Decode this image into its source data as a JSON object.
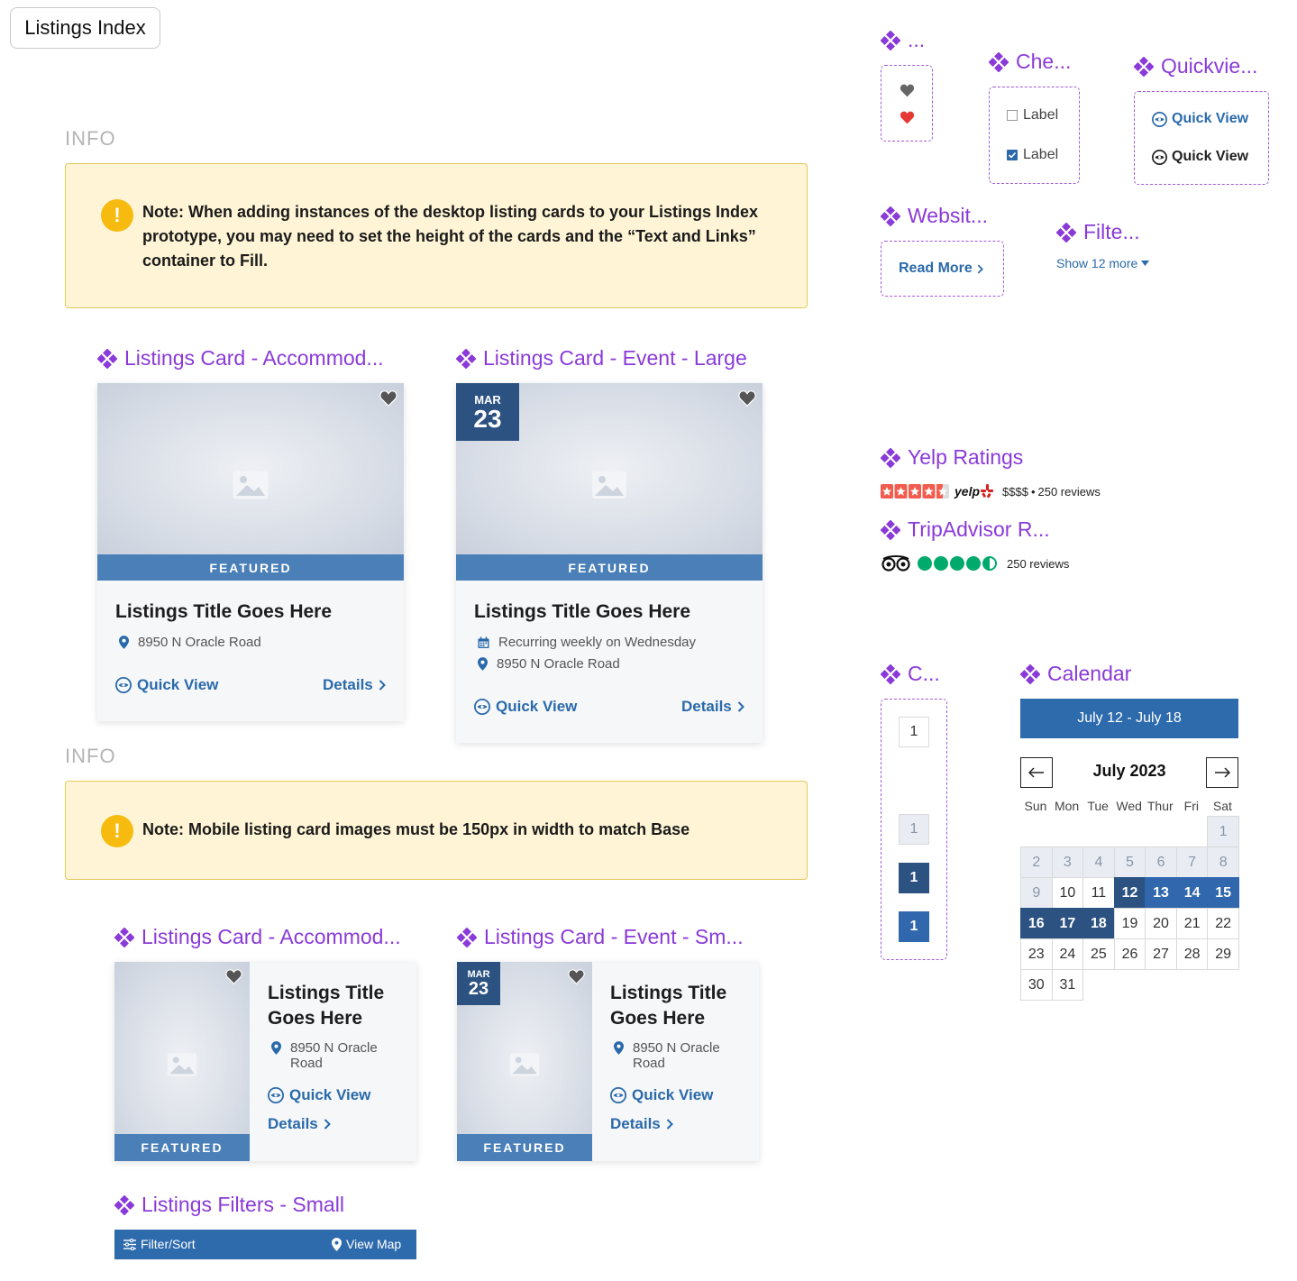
{
  "page": {
    "title": "Listings Index"
  },
  "info_sections": [
    {
      "label": "INFO",
      "note": "Note: When adding instances of the desktop listing cards to your Listings Index prototype, you may need to set the height of the cards and the “Text and Links” container to Fill."
    },
    {
      "label": "INFO",
      "note": "Note: Mobile listing card images must be 150px in width to match Base"
    }
  ],
  "components": {
    "favorite": "...",
    "checkbox": "Che...",
    "quickview": "Quickvie...",
    "website": "Websit...",
    "filter": "Filte...",
    "yelp": "Yelp Ratings",
    "tripadvisor": "TripAdvisor R...",
    "counter": "C...",
    "calendar": "Calendar",
    "card_accom_large": "Listings Card - Accommod...",
    "card_event_large": "Listings Card - Event - Large",
    "card_accom_small": "Listings Card - Accommod...",
    "card_event_small": "Listings Card - Event - Sm...",
    "filters_small": "Listings Filters - Small"
  },
  "card": {
    "featured": "FEATURED",
    "title": "Listings Title Goes Here",
    "title_line1": "Listings Title",
    "title_line2": "Goes Here",
    "address": "8950 N Oracle Road",
    "address_line1": "8950 N Oracle",
    "address_line2": "Road",
    "recurring": "Recurring weekly on Wednesday",
    "quick_view": "Quick View",
    "details": "Details",
    "month": "MAR",
    "day": "23"
  },
  "checkbox": {
    "label_unchecked": "Label",
    "label_checked": "Label",
    "checked": [
      false,
      true
    ]
  },
  "quickview_items": [
    "Quick View",
    "Quick View"
  ],
  "website": {
    "read_more": "Read More"
  },
  "filter_show": "Show 12 more",
  "yelp": {
    "stars": 4.5,
    "brand": "yelp",
    "price": "$$$$",
    "sep": "•",
    "reviews": "250 reviews"
  },
  "tripadvisor": {
    "rating": 4.5,
    "reviews": "250 reviews"
  },
  "counter": [
    "1",
    "1",
    "1",
    "1"
  ],
  "calendar": {
    "range": "July 12 - July 18",
    "month": "July 2023",
    "dow": [
      "Sun",
      "Mon",
      "Tue",
      "Wed",
      "Thur",
      "Fri",
      "Sat"
    ],
    "days": [
      "1",
      "2",
      "3",
      "4",
      "5",
      "6",
      "7",
      "8",
      "9",
      "10",
      "11",
      "12",
      "13",
      "14",
      "15",
      "16",
      "17",
      "18",
      "19",
      "20",
      "21",
      "22",
      "23",
      "24",
      "25",
      "26",
      "27",
      "28",
      "29",
      "30",
      "31"
    ],
    "first_weekday": 6,
    "dim_through": 9,
    "selected": [
      12,
      13,
      14,
      15,
      16,
      17,
      18
    ],
    "selected_ends": [
      12,
      18
    ]
  },
  "filters_bar": {
    "filter_sort": "Filter/Sort",
    "view_map": "View Map"
  },
  "colors": {
    "accent": "#8a3ad8",
    "primary": "#2a6aaa",
    "dark_blue": "#2c5282",
    "note_bg": "#fff5d6",
    "warning": "#f7bb10"
  }
}
